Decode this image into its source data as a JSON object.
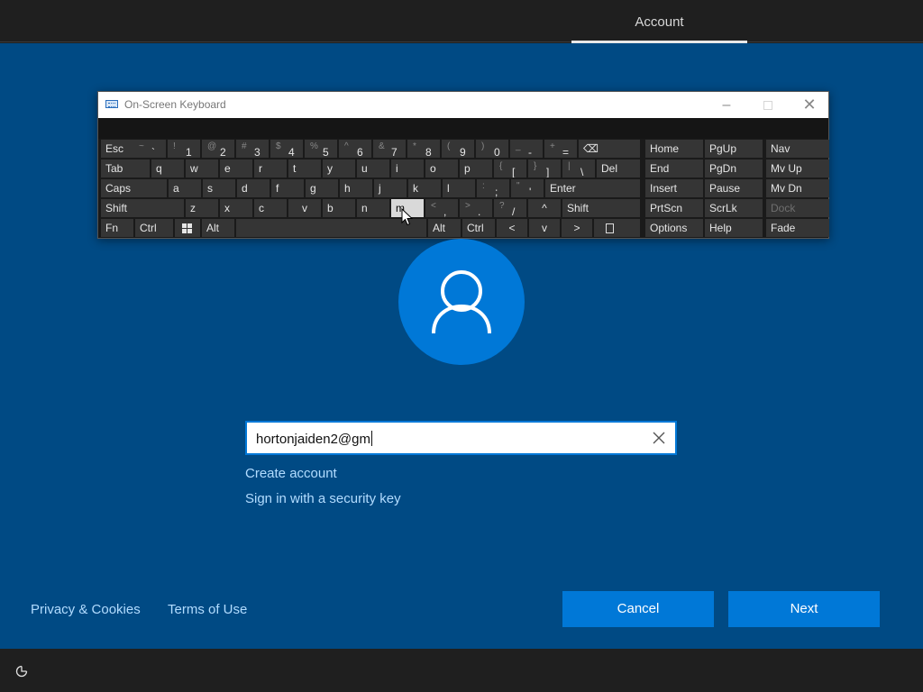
{
  "header": {
    "tab_account": "Account"
  },
  "osk": {
    "title": "On-Screen Keyboard",
    "minimize_glyph": "–",
    "close_glyph": "✕",
    "row1": [
      {
        "main": "Esc"
      },
      {
        "sub": "~",
        "main": "`"
      },
      {
        "sub": "!",
        "main": "1"
      },
      {
        "sub": "@",
        "main": "2"
      },
      {
        "sub": "#",
        "main": "3"
      },
      {
        "sub": "$",
        "main": "4"
      },
      {
        "sub": "%",
        "main": "5"
      },
      {
        "sub": "^",
        "main": "6"
      },
      {
        "sub": "&",
        "main": "7"
      },
      {
        "sub": "*",
        "main": "8"
      },
      {
        "sub": "(",
        "main": "9"
      },
      {
        "sub": ")",
        "main": "0"
      },
      {
        "sub": "_",
        "main": "-"
      },
      {
        "sub": "+",
        "main": "="
      },
      {
        "main": "⌫"
      }
    ],
    "row2": [
      {
        "main": "Tab"
      },
      {
        "main": "q"
      },
      {
        "main": "w"
      },
      {
        "main": "e"
      },
      {
        "main": "r"
      },
      {
        "main": "t"
      },
      {
        "main": "y"
      },
      {
        "main": "u"
      },
      {
        "main": "i"
      },
      {
        "main": "o"
      },
      {
        "main": "p"
      },
      {
        "sub": "{",
        "main": "["
      },
      {
        "sub": "}",
        "main": "]"
      },
      {
        "sub": "|",
        "main": "\\"
      },
      {
        "main": "Del"
      }
    ],
    "row3": [
      {
        "main": "Caps"
      },
      {
        "main": "a"
      },
      {
        "main": "s"
      },
      {
        "main": "d"
      },
      {
        "main": "f"
      },
      {
        "main": "g"
      },
      {
        "main": "h"
      },
      {
        "main": "j"
      },
      {
        "main": "k"
      },
      {
        "main": "l"
      },
      {
        "sub": ":",
        "main": ";"
      },
      {
        "sub": "\"",
        "main": "'"
      },
      {
        "main": "Enter"
      }
    ],
    "row4": [
      {
        "main": "Shift"
      },
      {
        "main": "z"
      },
      {
        "main": "x"
      },
      {
        "main": "c"
      },
      {
        "main": "v"
      },
      {
        "main": "b"
      },
      {
        "main": "n"
      },
      {
        "main": "m"
      },
      {
        "sub": "<",
        "main": ","
      },
      {
        "sub": ">",
        "main": "."
      },
      {
        "sub": "?",
        "main": "/"
      },
      {
        "main": "^"
      },
      {
        "main": "Shift"
      }
    ],
    "row5": [
      {
        "main": "Fn"
      },
      {
        "main": "Ctrl"
      },
      {
        "main": "win"
      },
      {
        "main": "Alt"
      },
      {
        "main": ""
      },
      {
        "main": "Alt"
      },
      {
        "main": "Ctrl"
      },
      {
        "main": "<"
      },
      {
        "main": "v"
      },
      {
        "main": ">"
      },
      {
        "main": "menu"
      }
    ],
    "nav": [
      [
        "Home",
        "PgUp",
        "Nav"
      ],
      [
        "End",
        "PgDn",
        "Mv Up"
      ],
      [
        "Insert",
        "Pause",
        "Mv Dn"
      ],
      [
        "PrtScn",
        "ScrLk",
        "Dock"
      ],
      [
        "Options",
        "Help",
        "Fade"
      ]
    ],
    "active_key": "m"
  },
  "form": {
    "email_value": "hortonjaiden2@gm",
    "create_account": "Create account",
    "security_key": "Sign in with a security key"
  },
  "footer": {
    "privacy": "Privacy & Cookies",
    "terms": "Terms of Use",
    "cancel": "Cancel",
    "next": "Next"
  },
  "colors": {
    "background": "#004a84",
    "accent": "#0078d7",
    "link": "#b2dcff",
    "bars": "#1f1f1f"
  }
}
